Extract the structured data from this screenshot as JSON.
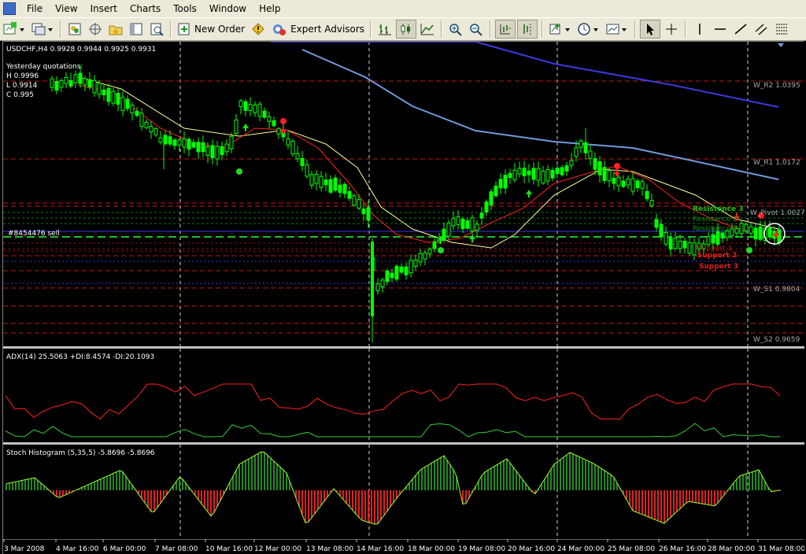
{
  "menubar": {
    "items": [
      "File",
      "View",
      "Insert",
      "Charts",
      "Tools",
      "Window",
      "Help"
    ]
  },
  "toolbar": {
    "new_order_label": "New Order",
    "expert_advisors_label": "Expert Advisors"
  },
  "chart": {
    "header": "USDCHF,H4  0.9928 0.9944 0.9925 0.9931",
    "yesterday": {
      "title": "Yesterday quotations:",
      "high": "H 0.9996",
      "low": "L 0.9914",
      "close": "C 0.995"
    },
    "order_label": "#8454476 sell",
    "levels": [
      {
        "label": "W_R2 1.0395"
      },
      {
        "label": "W_R1 1.0172"
      },
      {
        "label": "W_Pivot 1.0027"
      },
      {
        "label": "W_S1 0.9804"
      },
      {
        "label": "W_S2 0.9659"
      }
    ],
    "resistance_labels": [
      "Resistance 3",
      "Resistance 2",
      "Resistance 1"
    ],
    "support_labels": [
      "Support 1",
      "Support 2",
      "Support 3"
    ]
  },
  "adx": {
    "label": "ADX(14) 25.5063 +DI:8.4574 -DI:20.1093"
  },
  "stoch": {
    "label": "Stoch Histogram (5,35,5) -5.8696 -5.8696"
  },
  "time_axis": [
    "3 Mar 2008",
    "4 Mar 16:00",
    "6 Mar 00:00",
    "7 Mar 08:00",
    "10 Mar 16:00",
    "12 Mar 00:00",
    "13 Mar 08:00",
    "14 Mar 16:00",
    "18 Mar 00:00",
    "19 Mar 08:00",
    "20 Mar 16:00",
    "24 Mar 00:00",
    "25 Mar 08:00",
    "26 Mar 16:00",
    "28 Mar 00:00",
    "31 Mar 08:00"
  ],
  "colors": {
    "bull_candle": "#00ff00",
    "bear_candle": "#000000",
    "fast_ma": "#ff2020",
    "slow_ma": "#ffff99",
    "long_ma": "#6f9bdc",
    "longest_ma": "#3a3ae0",
    "resistance": "#00cc00",
    "support": "#ff3030",
    "pivot_level": "#ff4040",
    "adx_plus": "#33cc33",
    "adx_minus": "#ff2020",
    "histo_pos": "#1f8c1f",
    "histo_neg": "#e02020",
    "grid": "#ffffff"
  },
  "chart_data": {
    "type": "line",
    "price_axis": [
      "1.0395",
      "1.0172",
      "1.0027",
      "0.9804",
      "0.9659"
    ],
    "time_categories": [
      "3 Mar 2008",
      "4 Mar 16:00",
      "6 Mar 00:00",
      "7 Mar 08:00",
      "10 Mar 16:00",
      "12 Mar 00:00",
      "13 Mar 08:00",
      "14 Mar 16:00",
      "18 Mar 00:00",
      "19 Mar 08:00",
      "20 Mar 16:00",
      "24 Mar 00:00",
      "25 Mar 08:00",
      "26 Mar 16:00",
      "28 Mar 00:00",
      "31 Mar 08:00"
    ],
    "ohlc_close": [
      1.032,
      1.03,
      1.028,
      1.024,
      1.019,
      1.016,
      1.014,
      1.012,
      1.017,
      1.015,
      1.02,
      1.028,
      1.025,
      1.02,
      1.016,
      1.012,
      1.009,
      1.006,
      1.003,
      1.0,
      0.995,
      0.97,
      0.98,
      0.986,
      0.99,
      0.988,
      0.993,
      0.996,
      1.0,
      1.003,
      1.002,
      1.006,
      1.011,
      1.014,
      1.015,
      1.018,
      1.02,
      1.021,
      1.019,
      1.015,
      1.012,
      1.01,
      1.006,
      0.998,
      0.996,
      0.994,
      0.995,
      0.997,
      0.996,
      0.9931
    ]
  }
}
